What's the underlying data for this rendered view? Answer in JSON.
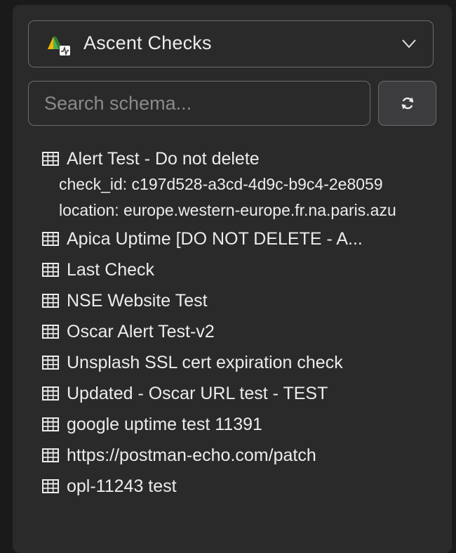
{
  "datasource": {
    "name": "Ascent Checks",
    "icon": "ascent-logo-icon"
  },
  "search": {
    "placeholder": "Search schema...",
    "value": ""
  },
  "refresh": {
    "icon": "refresh-icon"
  },
  "tree": {
    "items": [
      {
        "label": "Alert Test - Do not delete",
        "expanded": true,
        "details": [
          "check_id: c197d528-a3cd-4d9c-b9c4-2e8059",
          "location: europe.western-europe.fr.na.paris.azu"
        ]
      },
      {
        "label": "Apica Uptime [DO NOT DELETE - A..."
      },
      {
        "label": "Last Check"
      },
      {
        "label": "NSE Website Test"
      },
      {
        "label": "Oscar Alert Test-v2"
      },
      {
        "label": "Unsplash SSL cert expiration check"
      },
      {
        "label": "Updated - Oscar URL test - TEST"
      },
      {
        "label": "google uptime test 11391"
      },
      {
        "label": "https://postman-echo.com/patch"
      },
      {
        "label": "opl-11243 test"
      }
    ]
  },
  "colors": {
    "panel_bg": "#2a2a2a",
    "border": "#6b6b6b",
    "text": "#ececec",
    "placeholder": "#8a8a8a"
  }
}
